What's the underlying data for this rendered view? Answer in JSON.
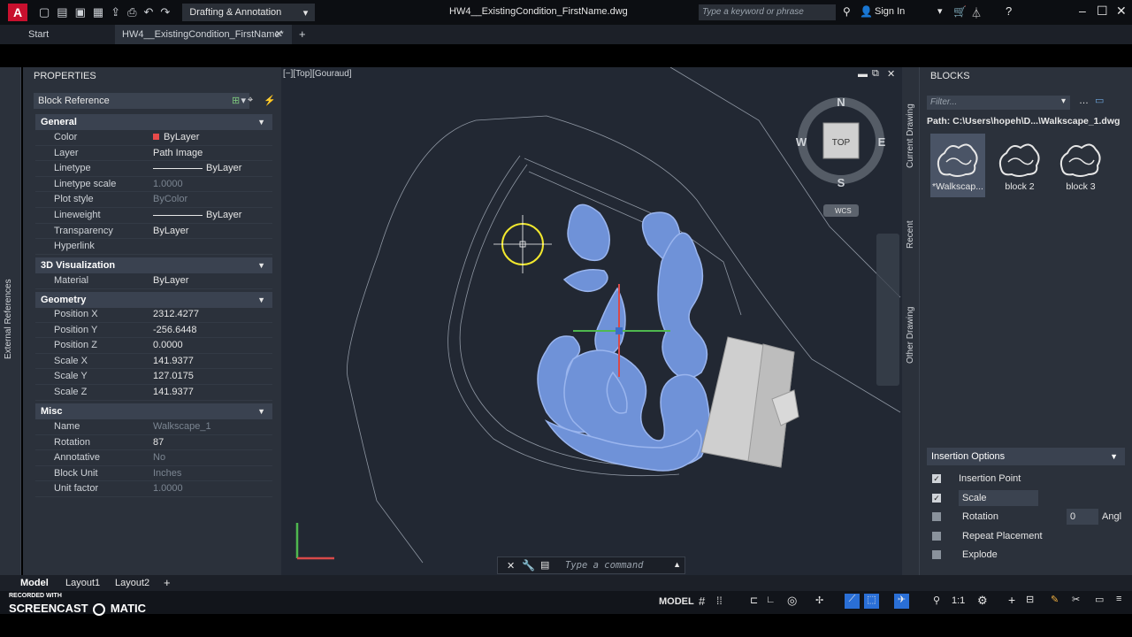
{
  "titlebar": {
    "workspace": "Drafting & Annotation",
    "document_title": "HW4__ExistingCondition_FirstName.dwg",
    "search_placeholder": "Type a keyword or phrase",
    "sign_in": "Sign In"
  },
  "tabs": {
    "start": "Start",
    "file": "HW4__ExistingCondition_FirstName*"
  },
  "left_strip": {
    "label": "External References"
  },
  "properties": {
    "header": "PROPERTIES",
    "selection": "Block Reference",
    "general": {
      "title": "General",
      "rows": [
        {
          "k": "Color",
          "v": "ByLayer"
        },
        {
          "k": "Layer",
          "v": "Path Image"
        },
        {
          "k": "Linetype",
          "v": "ByLayer"
        },
        {
          "k": "Linetype scale",
          "v": "1.0000"
        },
        {
          "k": "Plot style",
          "v": "ByColor"
        },
        {
          "k": "Lineweight",
          "v": "ByLayer"
        },
        {
          "k": "Transparency",
          "v": "ByLayer"
        },
        {
          "k": "Hyperlink",
          "v": ""
        }
      ]
    },
    "viz": {
      "title": "3D Visualization",
      "rows": [
        {
          "k": "Material",
          "v": "ByLayer"
        }
      ]
    },
    "geometry": {
      "title": "Geometry",
      "rows": [
        {
          "k": "Position X",
          "v": "2312.4277"
        },
        {
          "k": "Position Y",
          "v": "-256.6448"
        },
        {
          "k": "Position Z",
          "v": "0.0000"
        },
        {
          "k": "Scale X",
          "v": "141.9377"
        },
        {
          "k": "Scale Y",
          "v": "127.0175"
        },
        {
          "k": "Scale Z",
          "v": "141.9377"
        }
      ]
    },
    "misc": {
      "title": "Misc",
      "rows": [
        {
          "k": "Name",
          "v": "Walkscape_1"
        },
        {
          "k": "Rotation",
          "v": "87"
        },
        {
          "k": "Annotative",
          "v": "No"
        },
        {
          "k": "Block Unit",
          "v": "Inches"
        },
        {
          "k": "Unit factor",
          "v": "1.0000"
        }
      ]
    }
  },
  "viewport": {
    "label": "[−][Top][Gouraud]",
    "compass": {
      "n": "N",
      "s": "S",
      "e": "E",
      "w": "W",
      "top": "TOP",
      "wcs": "WCS"
    },
    "command_placeholder": "Type a command",
    "colors": {
      "block_fill": "#6f92d8",
      "block_outline": "#8aa8e8",
      "building": "#cfcfcf"
    }
  },
  "blocks": {
    "header": "BLOCKS",
    "filter_placeholder": "Filter...",
    "path": "Path: C:\\Users\\hopeh\\D...\\Walkscape_1.dwg",
    "side_tabs": [
      "Current Drawing",
      "Recent",
      "Other Drawing"
    ],
    "items": [
      "*Walkscap...",
      "block 2",
      "block 3"
    ],
    "insertion_options": {
      "title": "Insertion Options",
      "options": [
        {
          "label": "Insertion Point",
          "checked": true
        },
        {
          "label": "Scale",
          "checked": true
        },
        {
          "label": "Rotation",
          "checked": false
        },
        {
          "label": "Repeat Placement",
          "checked": false
        },
        {
          "label": "Explode",
          "checked": false
        }
      ],
      "rotation_value": "0",
      "angle_label": "Angl"
    }
  },
  "layout_tabs": [
    "Model",
    "Layout1",
    "Layout2"
  ],
  "status": {
    "model": "MODEL",
    "scale": "1:1"
  },
  "watermark": {
    "line1": "RECORDED WITH",
    "line2a": "SCREENCAST",
    "line2b": "MATIC"
  }
}
